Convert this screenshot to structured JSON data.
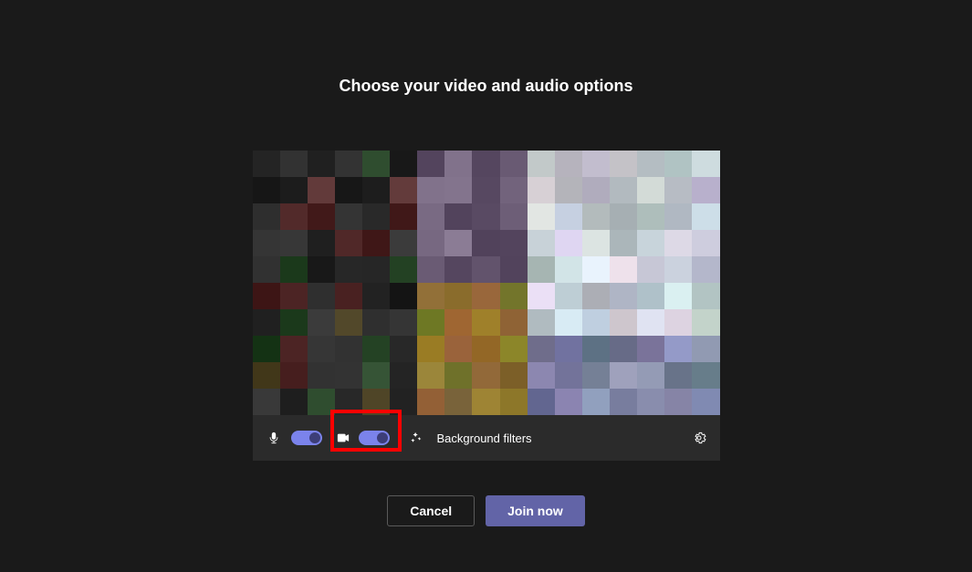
{
  "title": "Choose your video and audio options",
  "toolbar": {
    "mic_on": true,
    "camera_on": true,
    "background_filters_label": "Background filters"
  },
  "actions": {
    "cancel_label": "Cancel",
    "join_label": "Join now"
  },
  "highlight": {
    "target": "camera-toggle-group"
  }
}
